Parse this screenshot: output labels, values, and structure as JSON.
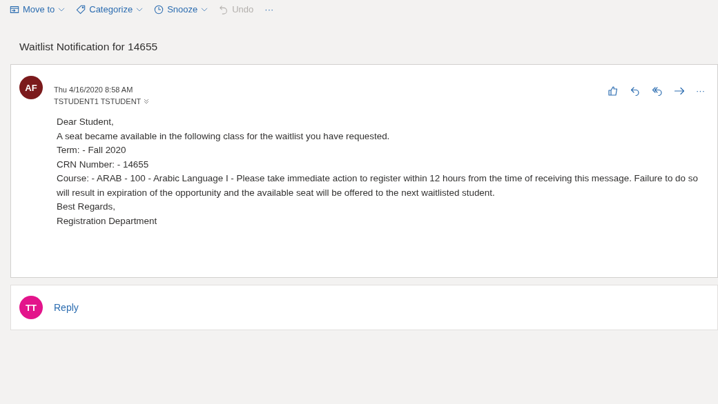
{
  "toolbar": [
    {
      "kind": "move",
      "label": "Move to",
      "dropdown": true,
      "disabled": false
    },
    {
      "kind": "categorize",
      "label": "Categorize",
      "dropdown": true,
      "disabled": false
    },
    {
      "kind": "snooze",
      "label": "Snooze",
      "dropdown": true,
      "disabled": false
    },
    {
      "kind": "undo",
      "label": "Undo",
      "dropdown": false,
      "disabled": true
    },
    {
      "kind": "more",
      "label": "···",
      "dropdown": false,
      "disabled": false
    }
  ],
  "subject": "Waitlist Notification for 14655",
  "message": {
    "avatar": {
      "initials": "AF",
      "color": "#7b1a1c"
    },
    "date": "Thu 4/16/2020 8:58 AM",
    "to": "TSTUDENT1 TSTUDENT",
    "actions": [
      {
        "kind": "like"
      },
      {
        "kind": "reply"
      },
      {
        "kind": "reply-all"
      },
      {
        "kind": "forward"
      },
      {
        "kind": "more",
        "label": "···"
      }
    ],
    "body": [
      "Dear Student,",
      "A seat became available in the following class for the waitlist you have requested.",
      "Term: - Fall 2020",
      "CRN Number: - 14655",
      "Course: - ARAB  - 100  - Arabic Language I  - Please take immediate action to register within 12 hours from the time of receiving  this message. Failure to do so will result in expiration of the opportunity and the available seat will be offered to the next waitlisted student.",
      "Best Regards,",
      "Registration Department"
    ]
  },
  "reply": {
    "avatar": {
      "initials": "TT",
      "color": "#e3148b"
    },
    "label": "Reply"
  }
}
